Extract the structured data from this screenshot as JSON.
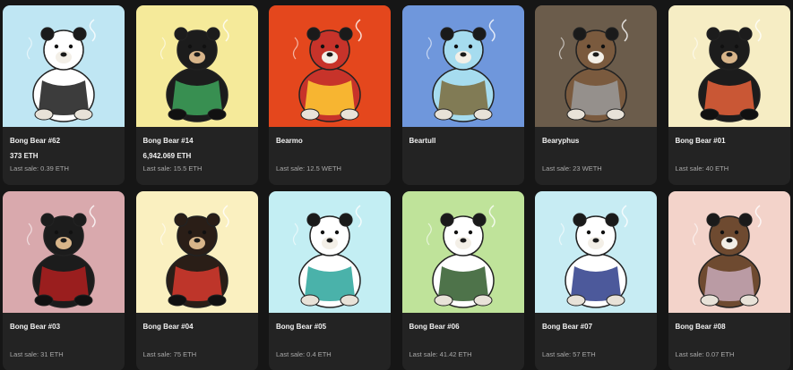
{
  "items": [
    {
      "name": "Bong Bear #62",
      "price": "373 ETH",
      "last_sale": "Last sale: 0.39 ETH",
      "bg": "#bfe6f3",
      "body": "#ffffff",
      "accent": "#1a1a1a"
    },
    {
      "name": "Bong Bear #14",
      "price": "6,942.069 ETH",
      "last_sale": "Last sale: 15.5 ETH",
      "bg": "#f5ea9a",
      "body": "#1c1c1c",
      "accent": "#3da35a"
    },
    {
      "name": "Bearmo",
      "price": "",
      "last_sale": "Last sale: 12.5 WETH",
      "bg": "#e4471d",
      "body": "#c7332a",
      "accent": "#ffcc33"
    },
    {
      "name": "Beartull",
      "price": "",
      "last_sale": "",
      "bg": "#6f97dc",
      "body": "#a6dcef",
      "accent": "#7a6a3a"
    },
    {
      "name": "Bearyphus",
      "price": "",
      "last_sale": "Last sale: 23 WETH",
      "bg": "#6b5c4b",
      "body": "#7a5a3e",
      "accent": "#9a9a9a"
    },
    {
      "name": "Bong Bear #01",
      "price": "",
      "last_sale": "Last sale: 40 ETH",
      "bg": "#f6edc4",
      "body": "#1c1c1c",
      "accent": "#e8623a"
    },
    {
      "name": "Bong Bear #03",
      "price": "",
      "last_sale": "Last sale: 31 ETH",
      "bg": "#d9a9ad",
      "body": "#1c1c1c",
      "accent": "#b01e1e"
    },
    {
      "name": "Bong Bear #04",
      "price": "",
      "last_sale": "Last sale: 75 ETH",
      "bg": "#faf0c0",
      "body": "#2a1e17",
      "accent": "#d83a2e"
    },
    {
      "name": "Bong Bear #05",
      "price": "",
      "last_sale": "Last sale: 0.4 ETH",
      "bg": "#c3eef3",
      "body": "#ffffff",
      "accent": "#2aa59b"
    },
    {
      "name": "Bong Bear #06",
      "price": "",
      "last_sale": "Last sale: 41.42 ETH",
      "bg": "#bfe39a",
      "body": "#ffffff",
      "accent": "#2f5a2a"
    },
    {
      "name": "Bong Bear #07",
      "price": "",
      "last_sale": "Last sale: 57 ETH",
      "bg": "#c7ecf3",
      "body": "#ffffff",
      "accent": "#2d3c8a"
    },
    {
      "name": "Bong Bear #08",
      "price": "",
      "last_sale": "Last sale: 0.07 ETH",
      "bg": "#f3d3ca",
      "body": "#6e4a30",
      "accent": "#c8a9b8"
    }
  ]
}
